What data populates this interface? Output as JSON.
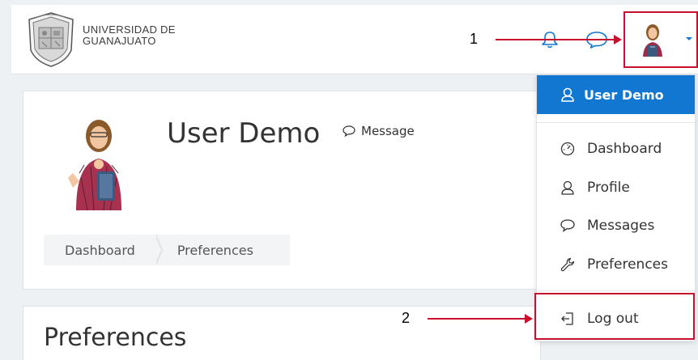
{
  "brand": {
    "line1": "UNIVERSIDAD DE",
    "line2": "GUANAJUATO"
  },
  "annotations": {
    "marker1": "1",
    "marker2": "2"
  },
  "profile": {
    "name": "User Demo",
    "message_label": "Message"
  },
  "breadcrumb": [
    "Dashboard",
    "Preferences"
  ],
  "page_title": "Preferences",
  "user_menu": {
    "header": "User Demo",
    "items": [
      {
        "label": "Dashboard",
        "icon": "dashboard-icon"
      },
      {
        "label": "Profile",
        "icon": "user-icon"
      },
      {
        "label": "Messages",
        "icon": "message-icon"
      },
      {
        "label": "Preferences",
        "icon": "wrench-icon"
      }
    ],
    "logout": {
      "label": "Log out",
      "icon": "logout-icon"
    }
  },
  "colors": {
    "accent": "#1177d1",
    "annotation": "#c8102e"
  }
}
